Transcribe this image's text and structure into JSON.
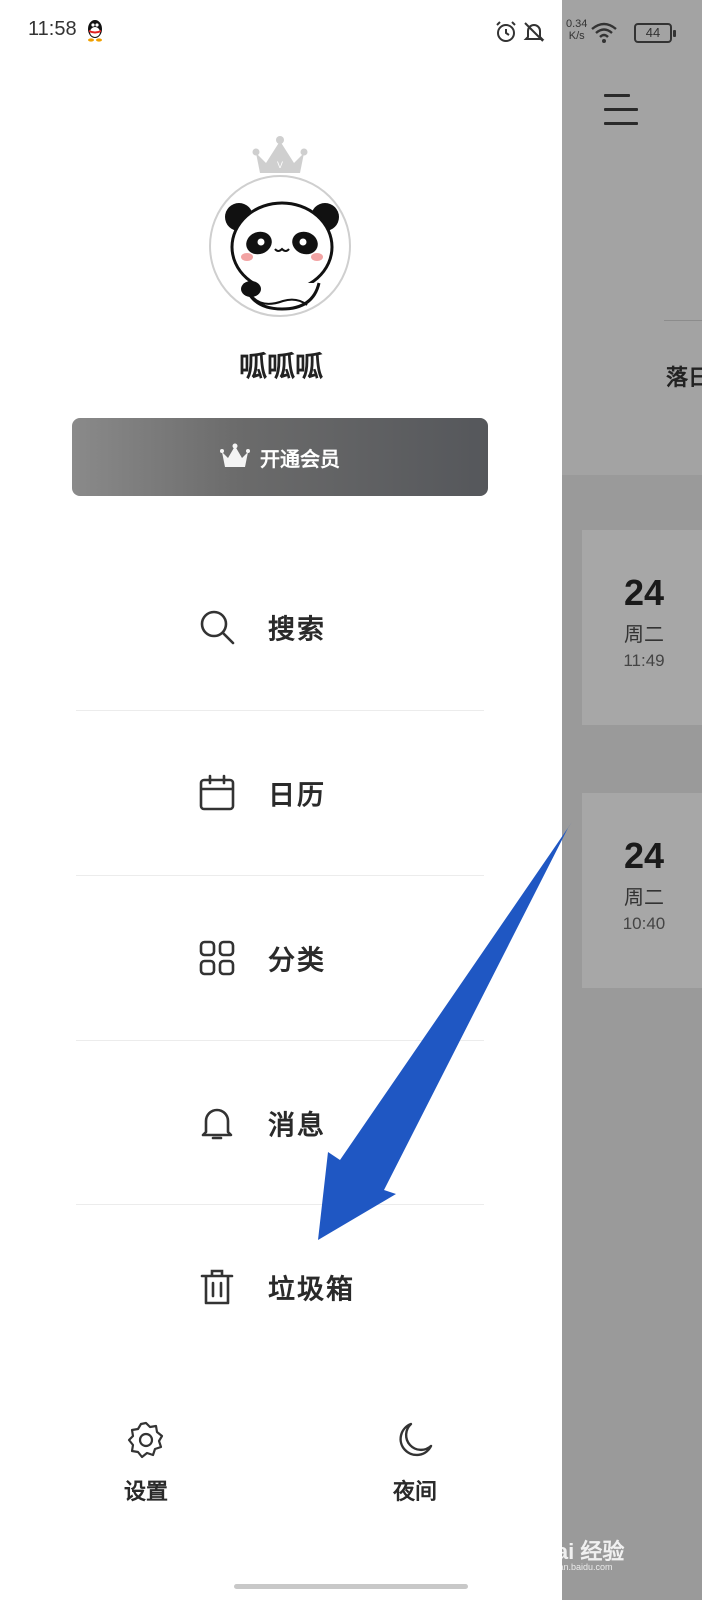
{
  "status_bar": {
    "time": "11:58",
    "net_speed_value": "0.34",
    "net_speed_unit": "K/s",
    "battery": "44"
  },
  "drawer": {
    "user_name": "呱呱呱",
    "vip_button_label": "开通会员",
    "menu": [
      {
        "label": "搜索",
        "icon": "search-icon"
      },
      {
        "label": "日历",
        "icon": "calendar-icon"
      },
      {
        "label": "分类",
        "icon": "grid-icon"
      },
      {
        "label": "消息",
        "icon": "bell-icon"
      },
      {
        "label": "垃圾箱",
        "icon": "trash-icon"
      }
    ],
    "bottom": {
      "settings_label": "设置",
      "night_label": "夜间"
    }
  },
  "main": {
    "title_partial": "落日",
    "notes": [
      {
        "day": "24",
        "weekday": "周二",
        "time": "11:49"
      },
      {
        "day": "24",
        "weekday": "周二",
        "time": "10:40"
      }
    ]
  },
  "watermark": {
    "text": "Bai 经验",
    "url": "jingyan.baidu.com"
  },
  "colors": {
    "annotation_arrow": "#1f57c3",
    "vip_button": "#5f6063",
    "dim_background": "#9a9a9a"
  }
}
